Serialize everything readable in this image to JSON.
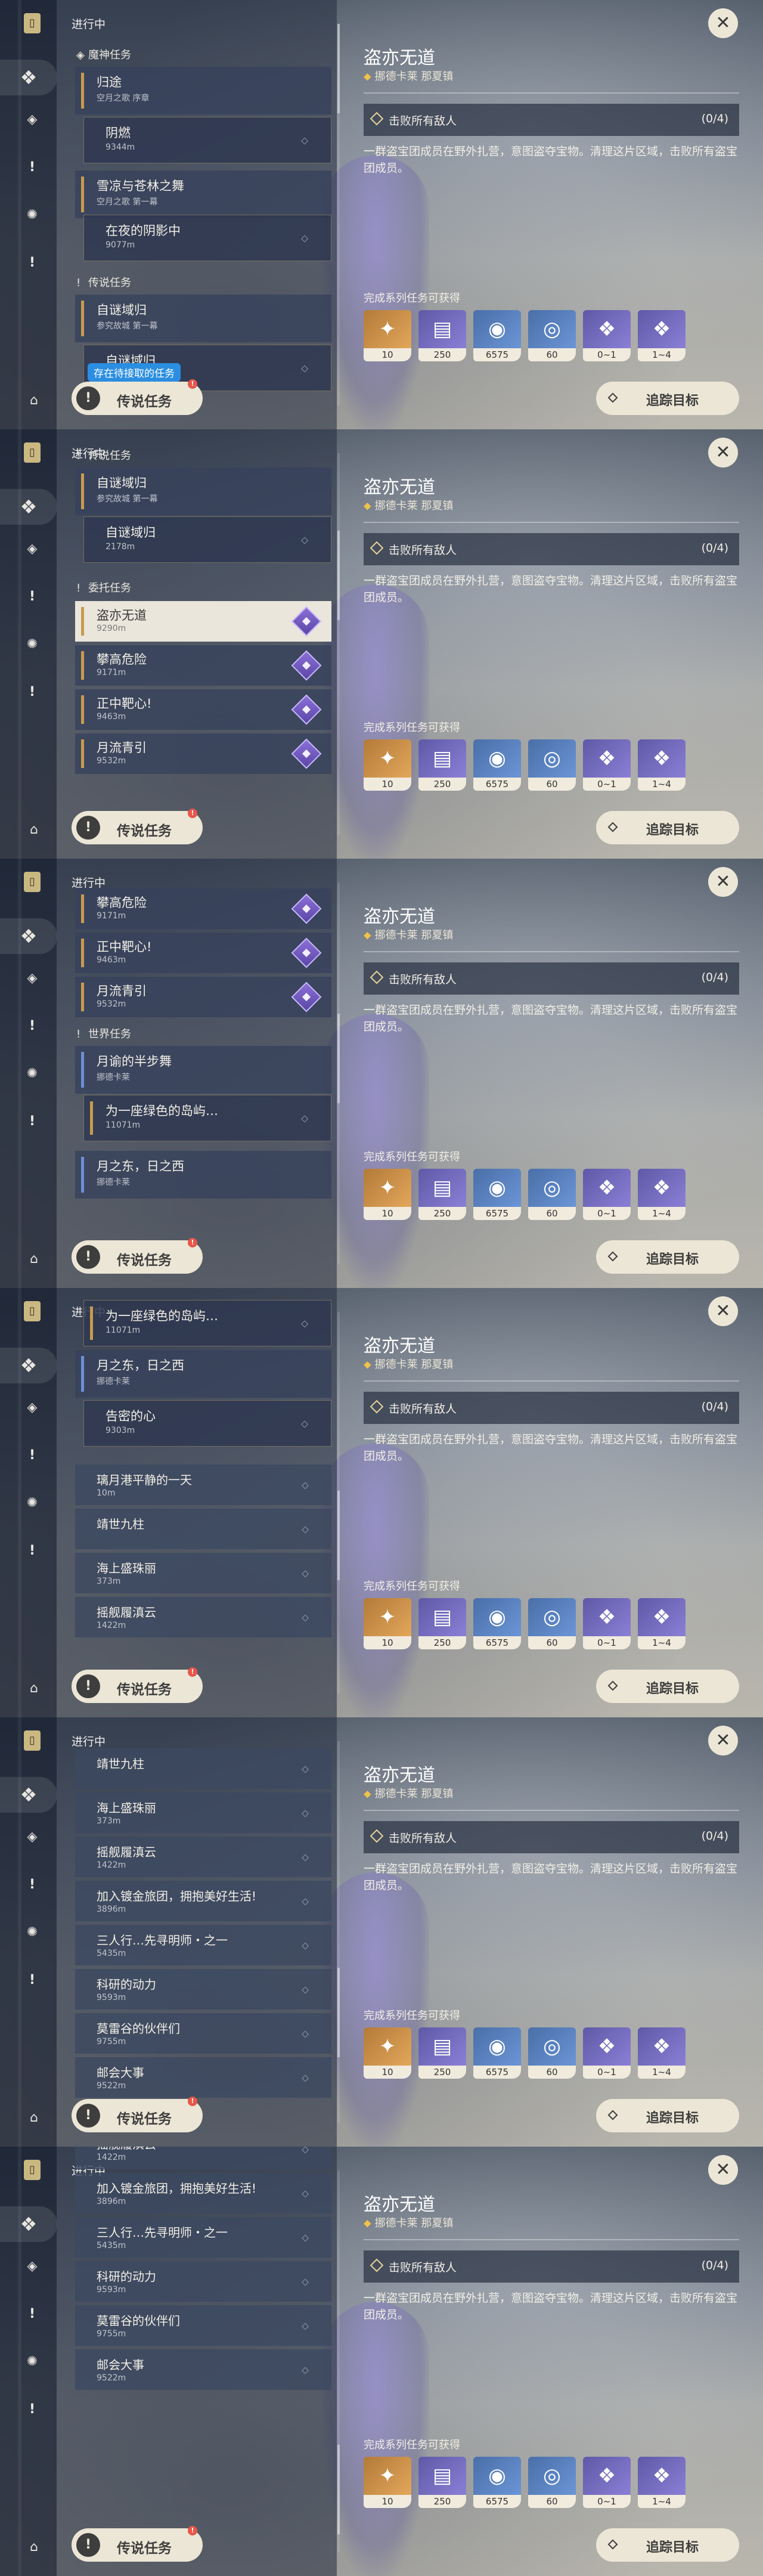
{
  "header": "进行中",
  "detail": {
    "title": "盗亦无道",
    "location": "挪德卡莱 那夏镇",
    "objective": "击败所有敌人",
    "progress": "(0/4)",
    "description": "一群盗宝团成员在野外扎营，意图盗夺宝物。清理这片区域，击败所有盗宝团成员。",
    "rewards_title": "完成系列任务可获得",
    "rewards": [
      {
        "icon": "intertwined-fate-icon",
        "count": "10",
        "tone": "gold",
        "glyph": "✦"
      },
      {
        "icon": "adventure-exp-icon",
        "count": "250",
        "tone": "purple",
        "glyph": "▤"
      },
      {
        "icon": "mora-icon",
        "count": "6575",
        "tone": "blue",
        "glyph": "◉"
      },
      {
        "icon": "primogem-icon",
        "count": "60",
        "tone": "blue",
        "glyph": "◎"
      },
      {
        "icon": "crystal-icon",
        "count": "0~1",
        "tone": "purple",
        "glyph": "❖"
      },
      {
        "icon": "crystal-icon",
        "count": "1~4",
        "tone": "purple",
        "glyph": "❖"
      }
    ]
  },
  "buttons": {
    "legend": "传说任务",
    "legend_badge": "!",
    "track": "追踪目标",
    "close": "✕",
    "tooltip": "存在待接取的任务"
  },
  "sections": {
    "archon": "魔神任务",
    "legend": "传说任务",
    "commission": "委托任务",
    "world": "世界任务"
  },
  "quests": {
    "guitu": {
      "title": "归途",
      "sub": "空月之歌 序章"
    },
    "yinran": {
      "title": "阴燃",
      "sub": "9344m"
    },
    "xueliang": {
      "title": "雪凉与苍林之舞",
      "sub": "空月之歌 第一幕"
    },
    "zaiyeyin": {
      "title": "在夜的阴影中",
      "sub": "9077m"
    },
    "zimi": {
      "title": "自谜域归",
      "sub": "参究故城 第一幕"
    },
    "zimi_sub": {
      "title": "自谜域归",
      "sub": "2178m"
    },
    "daoyi": {
      "title": "盗亦无道",
      "sub": "9290m"
    },
    "pangao": {
      "title": "攀高危险",
      "sub": "9171m"
    },
    "zhengzhong": {
      "title": "正中靶心!",
      "sub": "9463m"
    },
    "yueliu": {
      "title": "月流青引",
      "sub": "9532m"
    },
    "yueyu": {
      "title": "月谕的半步舞",
      "sub": "挪德卡莱"
    },
    "wei": {
      "title": "为一座绿色的岛屿…",
      "sub": "11071m"
    },
    "yuezhidong": {
      "title": "月之东，日之西",
      "sub": "挪德卡莱"
    },
    "gaomi": {
      "title": "告密的心",
      "sub": "9303m"
    },
    "liyue": {
      "title": "璃月港平静的一天",
      "sub": "10m"
    },
    "jingshi": {
      "title": "靖世九柱",
      "sub": ""
    },
    "haishang": {
      "title": "海上盛珠丽",
      "sub": "373m"
    },
    "yaojian": {
      "title": "摇舰履滇云",
      "sub": "1422m"
    },
    "jiaru": {
      "title": "加入镀金旅团，拥抱美好生活!",
      "sub": "3896m"
    },
    "sanren": {
      "title": "三人行…先寻明师・之一",
      "sub": "5435m"
    },
    "keyan": {
      "title": "科研的动力",
      "sub": "9593m"
    },
    "molei": {
      "title": "莫雷谷的伙伴们",
      "sub": "9755m"
    },
    "youhui": {
      "title": "邮会大事",
      "sub": "9522m"
    }
  }
}
